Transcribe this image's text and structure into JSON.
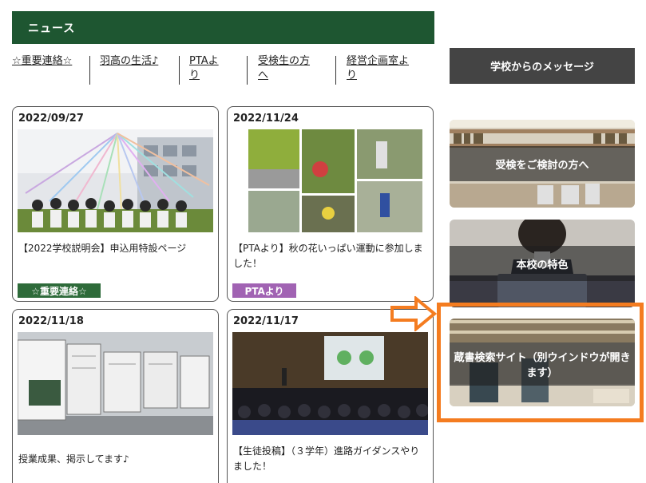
{
  "news": {
    "title": "ニュース",
    "tabs": [
      "☆重要連絡☆",
      "羽高の生活♪",
      "PTAより",
      "受検生の方へ",
      "経営企画室より"
    ]
  },
  "cards": [
    {
      "date": "2022/09/27",
      "title": "【2022学校説明会】申込用特設ページ",
      "tag": "☆重要連絡☆",
      "tag_color": "#2e6b3a"
    },
    {
      "date": "2022/11/24",
      "title": "【PTAより】秋の花いっぱい運動に参加しました！",
      "tag": "PTAより",
      "tag_color": "#a163b3"
    },
    {
      "date": "2022/11/18",
      "title": "授業成果、掲示してます♪"
    },
    {
      "date": "2022/11/17",
      "title": "【生徒投稿】（３学年）進路ガイダンスやりました！"
    }
  ],
  "sidebar": {
    "message_header": "学校からのメッセージ",
    "banners": [
      {
        "label": "受検をご検討の方へ"
      },
      {
        "label": "本校の特色"
      },
      {
        "label": "蔵書検索サイト（別ウインドウが開きます）"
      }
    ]
  },
  "colors": {
    "news_header_bg": "#1e5631",
    "message_header_bg": "#444444",
    "highlight": "#f47c20"
  }
}
